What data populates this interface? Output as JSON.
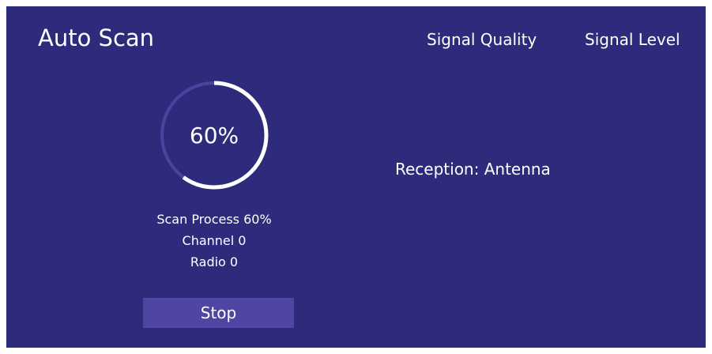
{
  "screen": {
    "title": "Auto Scan",
    "background_color": "#2e2b7c"
  },
  "header": {
    "signal_quality_label": "Signal Quality",
    "signal_level_label": "Signal Level"
  },
  "progress": {
    "percent": 60,
    "display": "60%",
    "ring_fill_color": "#ffffff",
    "ring_track_color": "#4a44a0"
  },
  "scan_info": {
    "process": "Scan Process 60%",
    "channel": "Channel 0",
    "radio": "Radio 0"
  },
  "buttons": {
    "stop_label": "Stop",
    "stop_color": "#4e46a2"
  },
  "reception": {
    "text": "Reception: Antenna"
  }
}
